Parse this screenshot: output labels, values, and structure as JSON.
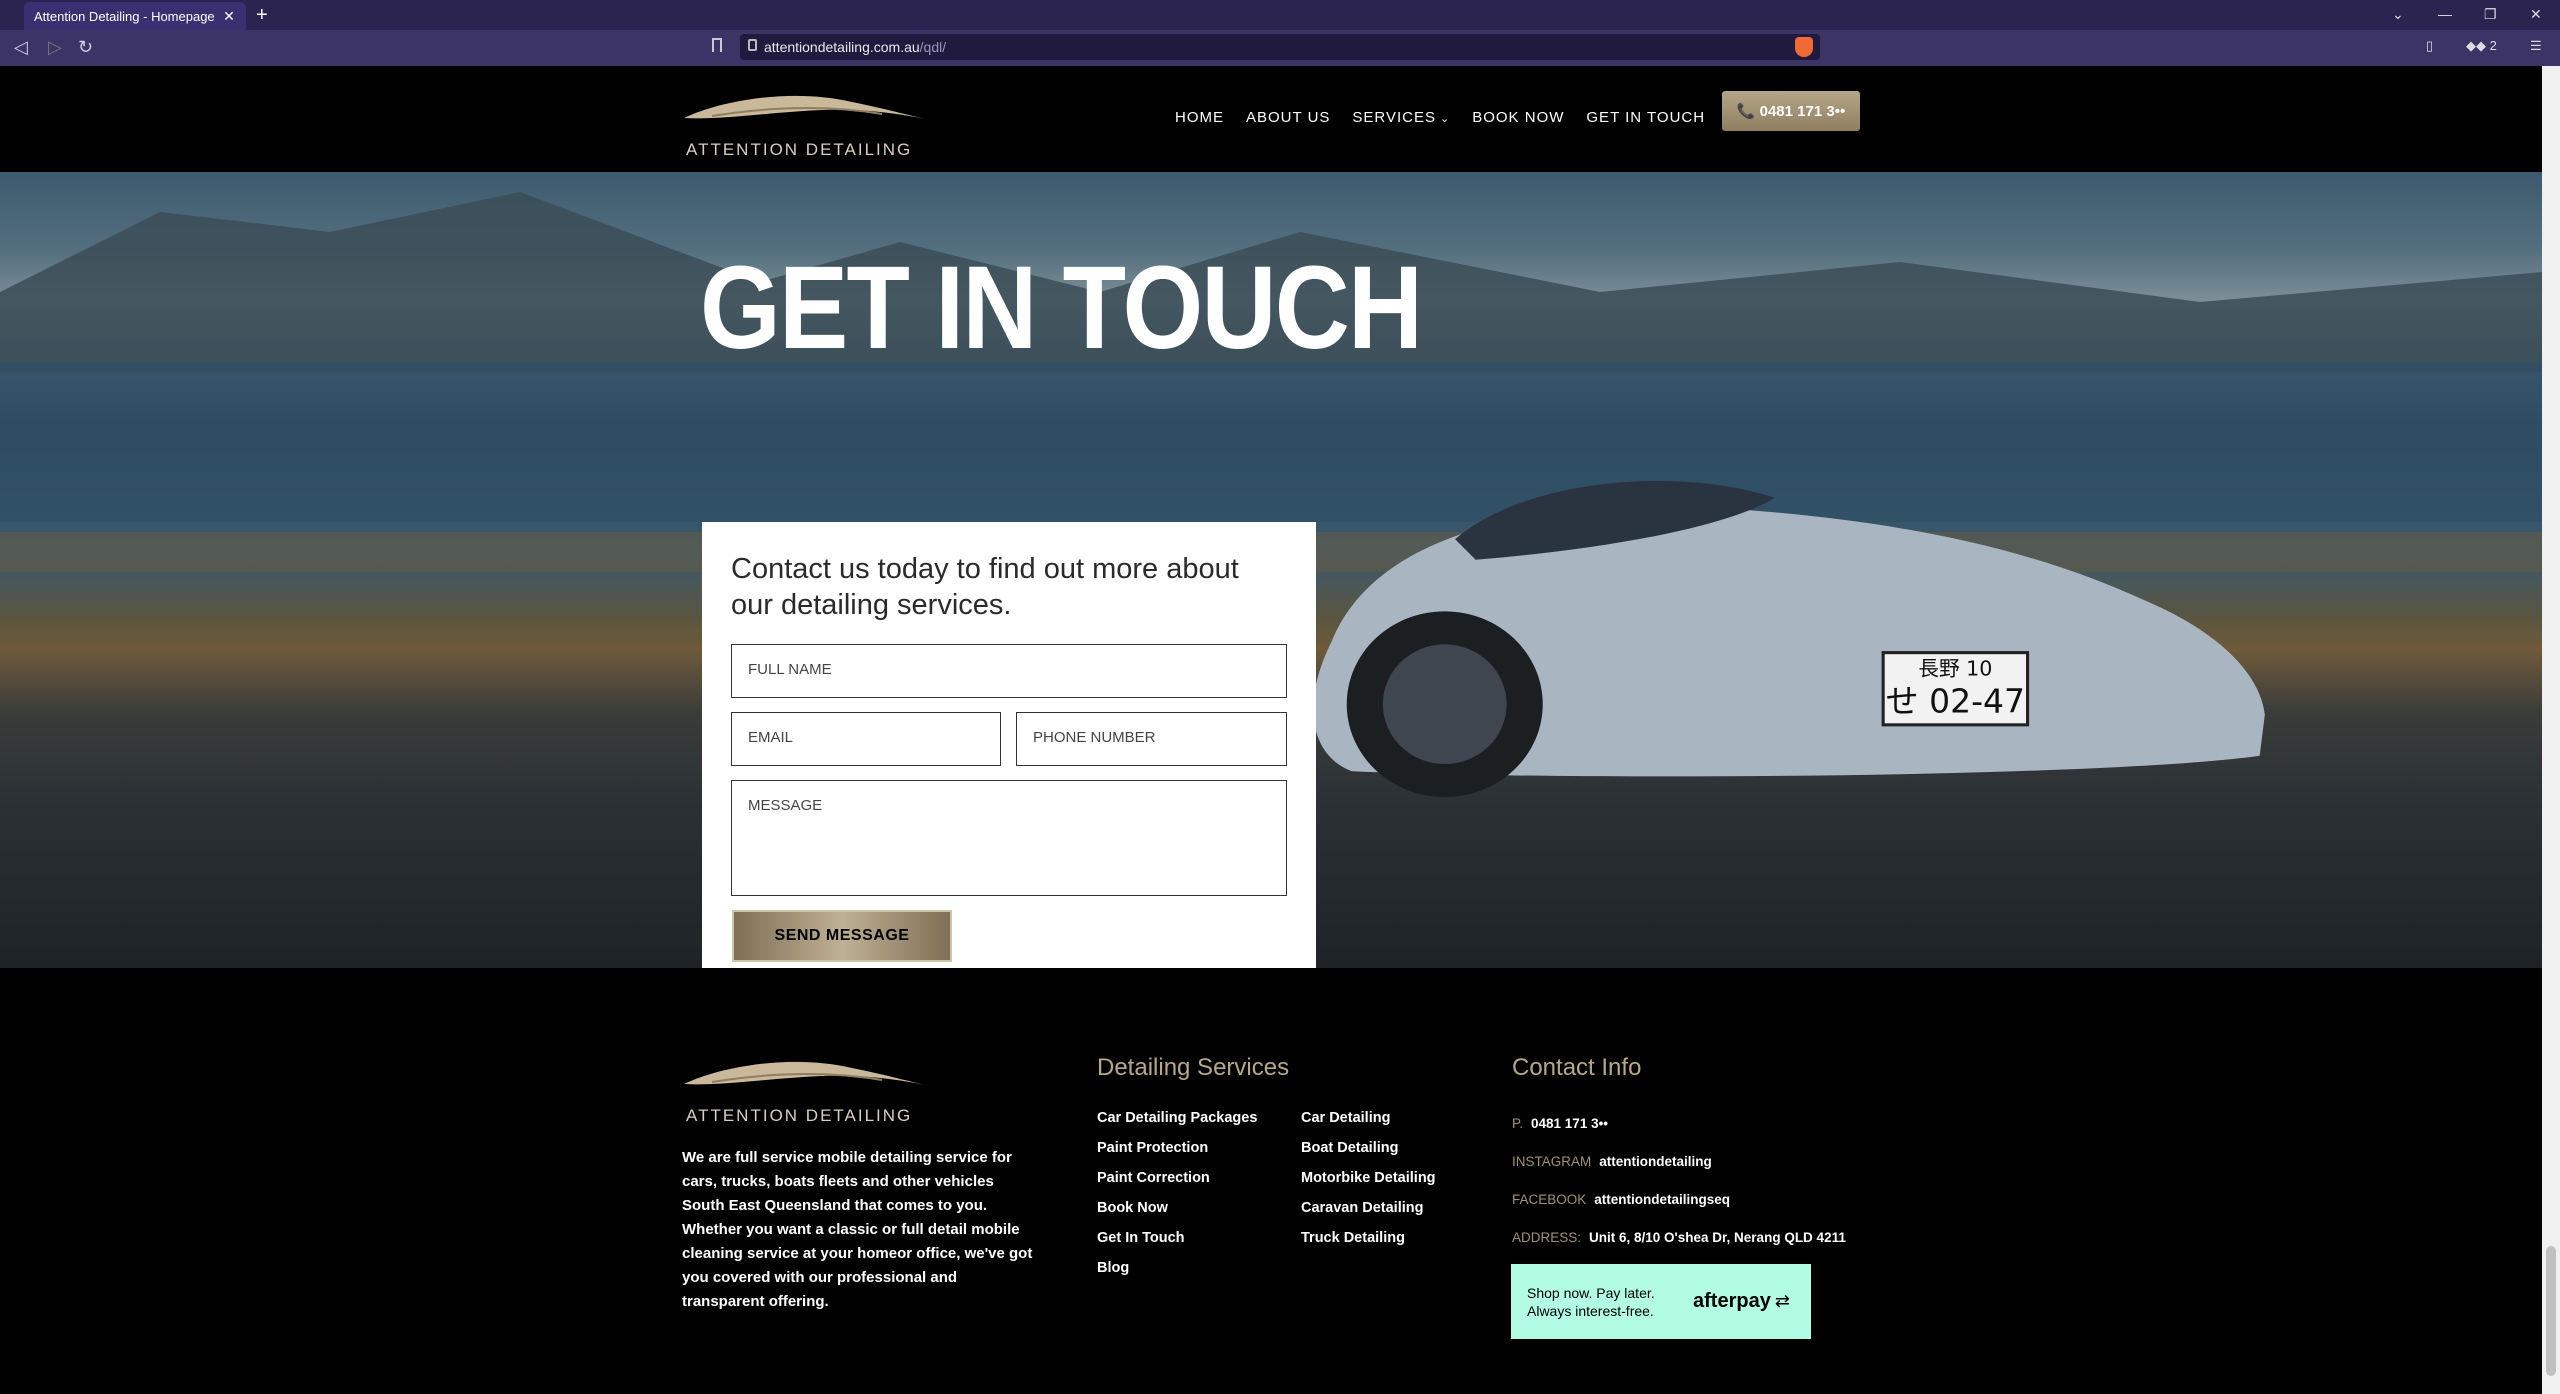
{
  "browser": {
    "tab_title": "Attention Detailing - Homepage",
    "url_domain": "attentiondetailing.com.au",
    "url_path": "/qdl/",
    "extension_count": "2"
  },
  "header": {
    "logo_text": "ATTENTION DETAILING",
    "nav": [
      "HOME",
      "ABOUT US",
      "SERVICES",
      "BOOK NOW",
      "GET IN TOUCH"
    ],
    "phone_button": "📞 0481 171 3••"
  },
  "hero": {
    "headline": "GET IN TOUCH",
    "intro": "Contact us today to find out more about our detailing services.",
    "fields": {
      "full_name": "FULL NAME",
      "email": "EMAIL",
      "phone": "PHONE NUMBER",
      "message": "MESSAGE"
    },
    "send_label": "SEND MESSAGE",
    "plate_top": "長野 10",
    "plate_bottom": "せ 02-47"
  },
  "footer": {
    "logo_text": "ATTENTION DETAILING",
    "about": "We are full service mobile detailing service for cars, trucks, boats fleets and other vehicles South East Queensland that comes to you. Whether you want a classic or full detail mobile cleaning service at your homeor office, we've got you covered with our professional and transparent offering.",
    "services_heading": "Detailing Services",
    "services_col1": [
      "Car Detailing Packages",
      "Paint Protection",
      "Paint Correction",
      "Book Now",
      "Get In Touch",
      "Blog"
    ],
    "services_col2": [
      "Car Detailing",
      "Boat Detailing",
      "Motorbike Detailing",
      "Caravan Detailing",
      "Truck Detailing"
    ],
    "contact_heading": "Contact Info",
    "contact": {
      "phone_label": "P.",
      "phone": "0481 171 3••",
      "instagram_label": "INSTAGRAM",
      "instagram": "attentiondetailing",
      "facebook_label": "FACEBOOK",
      "facebook": "attentiondetailingseq",
      "address_label": "ADDRESS:",
      "address": "Unit 6, 8/10 O'shea Dr, Nerang QLD 4211"
    },
    "afterpay_text": "Shop now. Pay later. Always interest-free.",
    "afterpay_brand": "afterpay"
  }
}
